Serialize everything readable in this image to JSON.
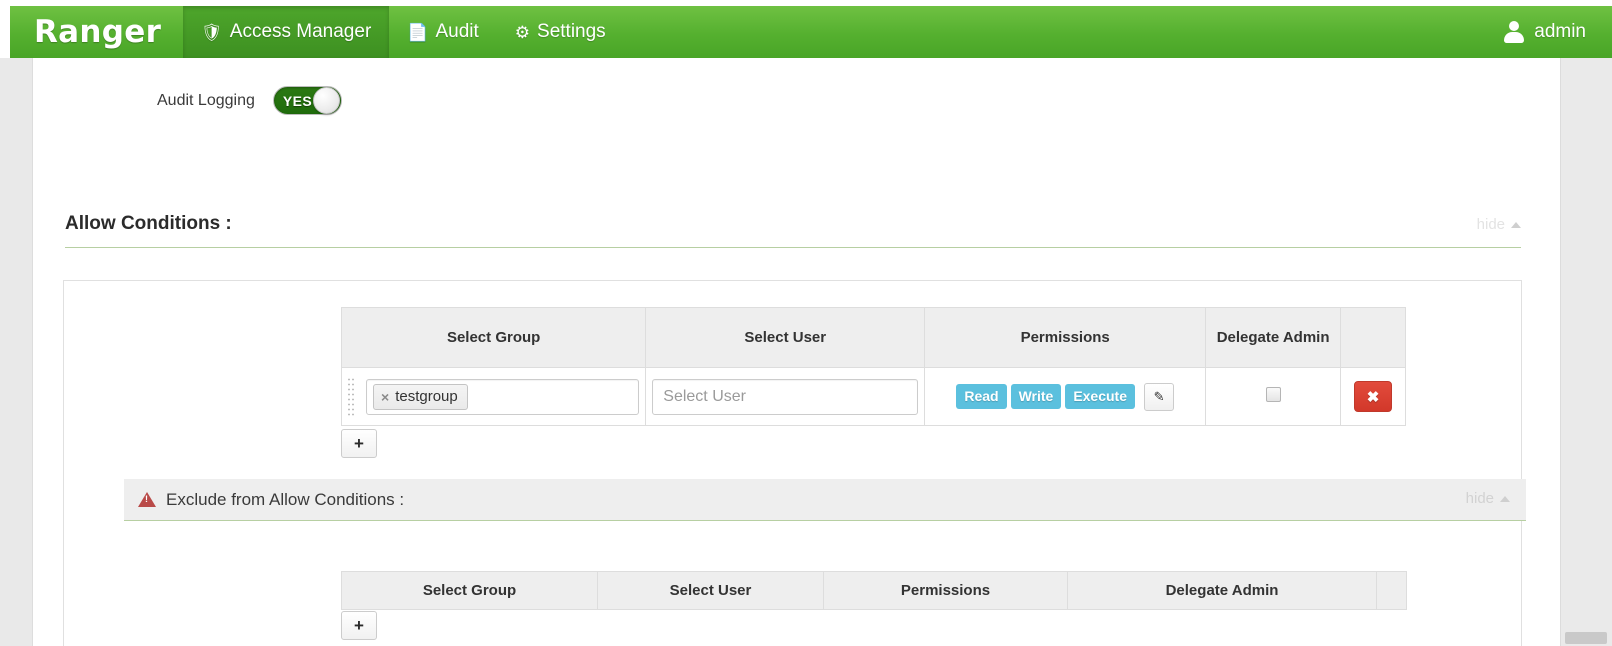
{
  "navbar": {
    "brand": "Ranger",
    "items": [
      {
        "label": "Access Manager",
        "icon": "shield-icon",
        "icon_glyph": "⛨",
        "active": true
      },
      {
        "label": "Audit",
        "icon": "file-icon",
        "icon_glyph": "὜E",
        "active": false
      },
      {
        "label": "Settings",
        "icon": "gear-icon",
        "icon_glyph": "⚙",
        "active": false
      }
    ],
    "user": {
      "name": "admin",
      "icon": "user-avatar-icon"
    },
    "colors": {
      "bar_top": "#6fc142",
      "bar_bottom": "#49a527",
      "active_tab": "#3d9021"
    }
  },
  "audit_logging": {
    "label": "Audit Logging",
    "toggle_value": "YES",
    "toggle_on": true,
    "color_on": "#2c7a13"
  },
  "allow_conditions": {
    "title": "Allow Conditions :",
    "hide_label": "hide",
    "table": {
      "headers": {
        "group": "Select Group",
        "user": "Select User",
        "permissions": "Permissions",
        "delegate_admin": "Delegate Admin",
        "actions": ""
      },
      "rows": [
        {
          "group_tokens": [
            {
              "label": "testgroup",
              "remove": "×"
            }
          ],
          "user_placeholder": "Select User",
          "user_value": "",
          "permissions": [
            "Read",
            "Write",
            "Execute"
          ],
          "edit_icon": "pencil-icon",
          "delegate_admin_checked": false,
          "delete_label": "✖"
        }
      ],
      "add_label": "+"
    }
  },
  "exclude_conditions": {
    "title": "Exclude from Allow Conditions :",
    "warning_icon": "warning-triangle-icon",
    "hide_label": "hide",
    "table": {
      "headers": {
        "group": "Select Group",
        "user": "Select User",
        "permissions": "Permissions",
        "delegate_admin": "Delegate Admin",
        "actions": ""
      },
      "rows": [],
      "add_label": "+"
    }
  },
  "colors": {
    "badge": "#5bc0de",
    "delete": "#d2382a",
    "green_rule": "#b7cfa2"
  }
}
